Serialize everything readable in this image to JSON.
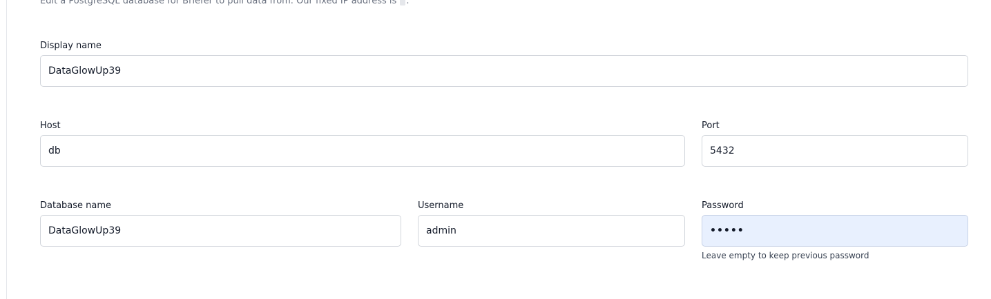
{
  "intro": {
    "text": "Edit a PostgreSQL database for Briefer to pull data from. Our fixed IP address is",
    "suffix": "."
  },
  "fields": {
    "display_name": {
      "label": "Display name",
      "value": "DataGlowUp39"
    },
    "host": {
      "label": "Host",
      "value": "db"
    },
    "port": {
      "label": "Port",
      "value": "5432"
    },
    "database_name": {
      "label": "Database name",
      "value": "DataGlowUp39"
    },
    "username": {
      "label": "Username",
      "value": "admin"
    },
    "password": {
      "label": "Password",
      "value": "•••••",
      "hint": "Leave empty to keep previous password"
    }
  },
  "colors": {
    "autofill_bg": "#e8f0fe",
    "border": "#d1d5db",
    "muted_text": "#6b7280"
  }
}
